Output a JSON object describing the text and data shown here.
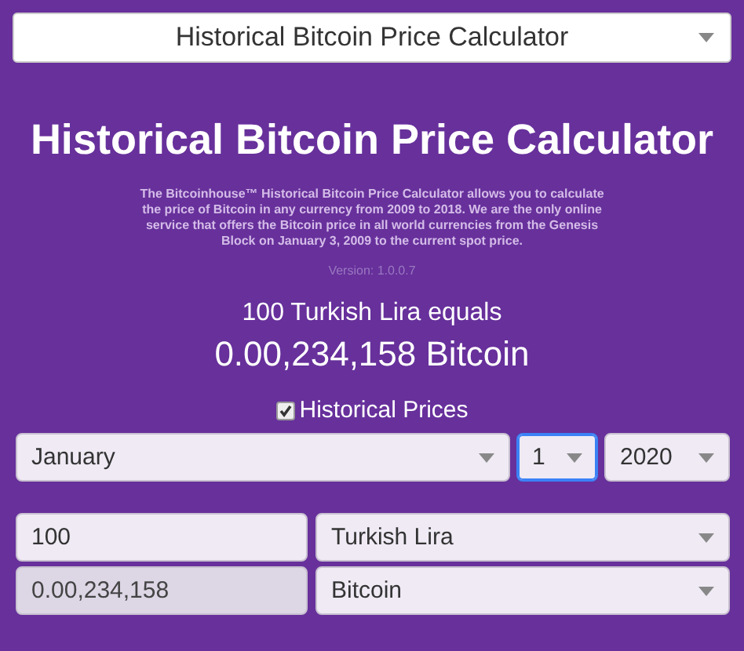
{
  "page_selector": {
    "value": "Historical Bitcoin Price Calculator"
  },
  "title": "Historical Bitcoin Price Calculator",
  "description": "The Bitcoinhouse™ Historical Bitcoin Price Calculator allows you to calculate the price of Bitcoin in any currency from 2009 to 2018. We are the only online service that offers the Bitcoin price in all world currencies from the Genesis Block on January 3, 2009 to the current spot price.",
  "version": "Version: 1.0.0.7",
  "result": {
    "summary": "100 Turkish Lira equals",
    "amount": "0.00,234,158 Bitcoin"
  },
  "historical_prices": {
    "label": "Historical Prices",
    "checked": true
  },
  "date": [
    {
      "kind": "select",
      "value": "January",
      "focused": false
    },
    {
      "kind": "select",
      "value": "1",
      "focused": true
    },
    {
      "kind": "select",
      "value": "2020",
      "focused": false
    }
  ],
  "conversion": [
    [
      {
        "kind": "input",
        "value": "100",
        "readonly": false
      },
      {
        "kind": "select",
        "value": "Turkish Lira",
        "focused": false
      }
    ],
    [
      {
        "kind": "input",
        "value": "0.00,234,158",
        "readonly": true
      },
      {
        "kind": "select",
        "value": "Bitcoin",
        "focused": false
      }
    ]
  ]
}
